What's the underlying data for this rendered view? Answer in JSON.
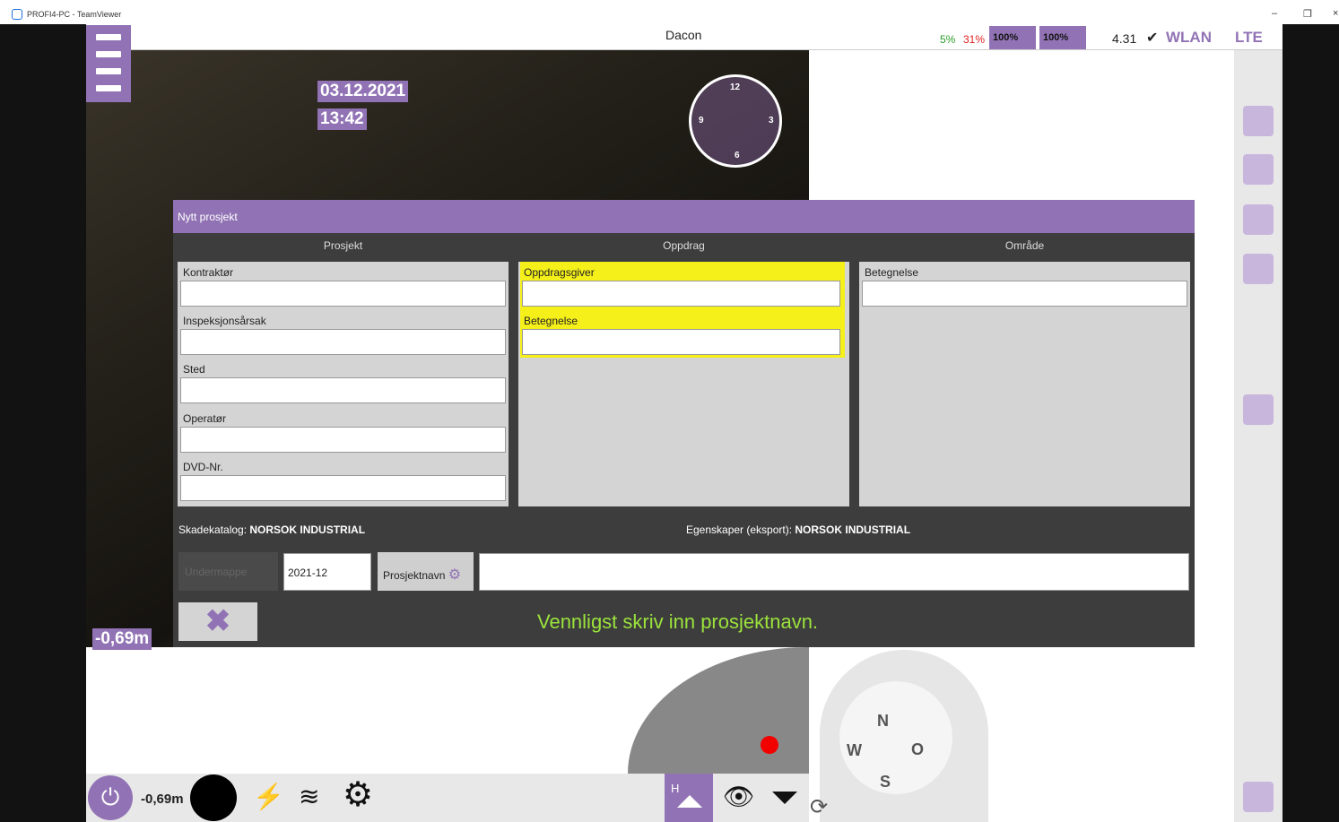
{
  "window": {
    "title": "PROFI4-PC - TeamViewer",
    "min": "–",
    "restore": "❐",
    "close": "×"
  },
  "app": {
    "title": "Dacon"
  },
  "status": {
    "pct1": "5%",
    "pct2": "31%",
    "badge1": "100%",
    "badge2": "100%",
    "version": "4.31",
    "check": "✔",
    "wlan": "WLAN",
    "lte": "LTE"
  },
  "overlay": {
    "date": "03.12.2021",
    "time": "13:42",
    "clock": [
      "12",
      "3",
      "6",
      "9"
    ],
    "depth_label": "-0,69m"
  },
  "dialog": {
    "title": "Nytt prosjekt",
    "columns": [
      {
        "header": "Prosjekt",
        "fields": [
          {
            "label": "Kontraktør",
            "value": ""
          },
          {
            "label": "Inspeksjonsårsak",
            "value": ""
          },
          {
            "label": "Sted",
            "value": ""
          },
          {
            "label": "Operatør",
            "value": ""
          },
          {
            "label": "DVD-Nr.",
            "value": ""
          }
        ]
      },
      {
        "header": "Oppdrag",
        "fields": [
          {
            "label": "Oppdragsgiver",
            "value": ""
          },
          {
            "label": "Betegnelse",
            "value": ""
          }
        ]
      },
      {
        "header": "Område",
        "fields": [
          {
            "label": "Betegnelse",
            "value": ""
          }
        ]
      }
    ],
    "skade_label": "Skadekatalog: ",
    "skade_value": "NORSOK INDUSTRIAL",
    "egen_label": "Egenskaper (eksport): ",
    "egen_value": "NORSOK INDUSTRIAL",
    "undermappe": "Undermappe",
    "year": "2021-12",
    "projektnavn_btn": "Prosjektnavn",
    "projektnavn_value": "",
    "cancel": "✖",
    "message": "Vennligst skriv inn prosjektnavn."
  },
  "bottom": {
    "depth": "-0,69m",
    "h_label": "H"
  },
  "compass": {
    "n": "N",
    "s": "S",
    "w": "W",
    "o": "O"
  },
  "colors": {
    "accent": "#9173b5",
    "required": "#f5ef1a",
    "message": "#9be33c",
    "record": "#f20000"
  },
  "icons": [
    "menu-icon",
    "clock-icon",
    "power-icon",
    "lightning-icon",
    "signal-icon",
    "gear-icon",
    "home-up-icon",
    "eye-icon",
    "triangle-down-icon",
    "refresh-icon",
    "arrow-icon"
  ]
}
